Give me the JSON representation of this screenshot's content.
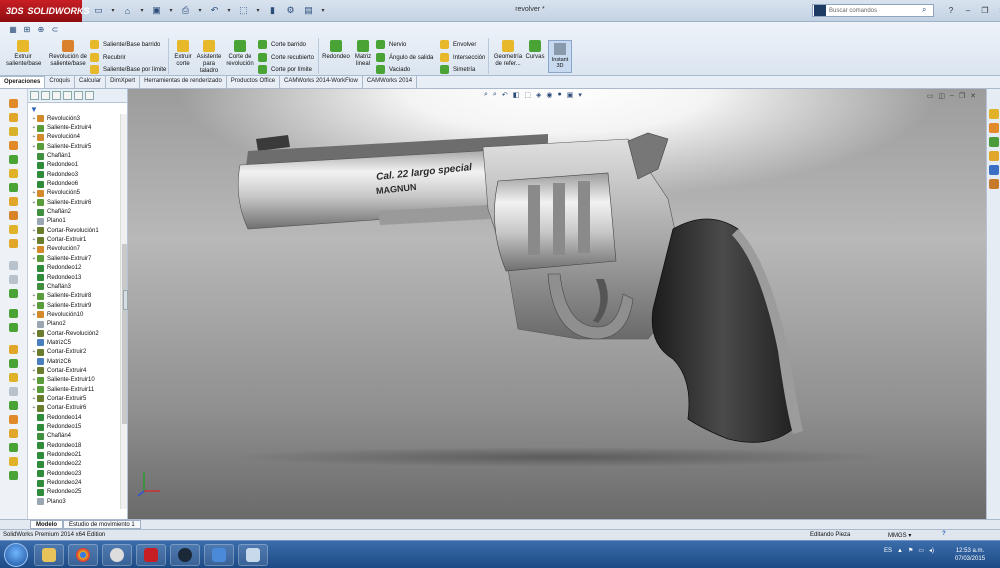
{
  "app": {
    "logo_text": "SOLIDWORKS",
    "doc_title": "revolver *",
    "search_placeholder": "Buscar comandos"
  },
  "ribbon": {
    "buttons": [
      {
        "label": "Extruir saliente/base"
      },
      {
        "label": "Revolución de saliente/base"
      },
      {
        "label": "Extruir corte"
      },
      {
        "label": "Asistente para taladro"
      },
      {
        "label": "Corte de revolución"
      },
      {
        "label": "Redondeo"
      },
      {
        "label": "Matriz lineal"
      },
      {
        "label": "Geometría de refer..."
      },
      {
        "label": "Curvas"
      },
      {
        "label": "Instant 3D"
      }
    ],
    "small": [
      {
        "label": "Saliente/Base barrido"
      },
      {
        "label": "Recubrir"
      },
      {
        "label": "Saliente/Base por límite"
      },
      {
        "label": "Corte barrido"
      },
      {
        "label": "Corte recubierto"
      },
      {
        "label": "Corte por límite"
      },
      {
        "label": "Nervio"
      },
      {
        "label": "Ángulo de salida"
      },
      {
        "label": "Vaciado"
      },
      {
        "label": "Envolver"
      },
      {
        "label": "Intersección"
      },
      {
        "label": "Simetría"
      }
    ]
  },
  "tabs": [
    "Operaciones",
    "Croquis",
    "Calcular",
    "DimXpert",
    "Herramientas de renderizado",
    "Productos Office",
    "CAMWorks 2014-WorkFlow",
    "CAMWorks 2014"
  ],
  "tree": [
    {
      "label": "Revolución3",
      "icon": "revolve",
      "exp": "+"
    },
    {
      "label": "Saliente-Extruir4",
      "icon": "extrude",
      "exp": "+"
    },
    {
      "label": "Revolución4",
      "icon": "revolve",
      "exp": "+"
    },
    {
      "label": "Saliente-Extruir5",
      "icon": "extrude",
      "exp": "+"
    },
    {
      "label": "Chaflán1",
      "icon": "chamfer",
      "exp": ""
    },
    {
      "label": "Redondeo1",
      "icon": "fillet",
      "exp": ""
    },
    {
      "label": "Redondeo3",
      "icon": "fillet",
      "exp": ""
    },
    {
      "label": "Redondeo6",
      "icon": "fillet",
      "exp": ""
    },
    {
      "label": "Revolución5",
      "icon": "revolve",
      "exp": "+"
    },
    {
      "label": "Saliente-Extruir6",
      "icon": "extrude",
      "exp": "+"
    },
    {
      "label": "Chaflán2",
      "icon": "chamfer",
      "exp": ""
    },
    {
      "label": "Plano1",
      "icon": "plane",
      "exp": ""
    },
    {
      "label": "Cortar-Revolución1",
      "icon": "cut",
      "exp": "+"
    },
    {
      "label": "Cortar-Extruir1",
      "icon": "cut",
      "exp": "+"
    },
    {
      "label": "Revolución7",
      "icon": "revolve",
      "exp": "+"
    },
    {
      "label": "Saliente-Extruir7",
      "icon": "extrude",
      "exp": "+"
    },
    {
      "label": "Redondeo12",
      "icon": "fillet",
      "exp": ""
    },
    {
      "label": "Redondeo13",
      "icon": "fillet",
      "exp": ""
    },
    {
      "label": "Chaflán3",
      "icon": "chamfer",
      "exp": ""
    },
    {
      "label": "Saliente-Extruir8",
      "icon": "extrude",
      "exp": "+"
    },
    {
      "label": "Saliente-Extruir9",
      "icon": "extrude",
      "exp": "+"
    },
    {
      "label": "Revolución10",
      "icon": "revolve",
      "exp": "+"
    },
    {
      "label": "Plano2",
      "icon": "plane",
      "exp": ""
    },
    {
      "label": "Cortar-Revolución2",
      "icon": "cut",
      "exp": "+"
    },
    {
      "label": "MatrizC5",
      "icon": "pattern",
      "exp": ""
    },
    {
      "label": "Cortar-Extruir2",
      "icon": "cut",
      "exp": "+"
    },
    {
      "label": "MatrizC6",
      "icon": "pattern",
      "exp": ""
    },
    {
      "label": "Cortar-Extruir4",
      "icon": "cut",
      "exp": "+"
    },
    {
      "label": "Saliente-Extruir10",
      "icon": "extrude",
      "exp": "+"
    },
    {
      "label": "Saliente-Extruir11",
      "icon": "extrude",
      "exp": "+"
    },
    {
      "label": "Cortar-Extruir5",
      "icon": "cut",
      "exp": "+"
    },
    {
      "label": "Cortar-Extruir6",
      "icon": "cut",
      "exp": "+"
    },
    {
      "label": "Redondeo14",
      "icon": "fillet",
      "exp": ""
    },
    {
      "label": "Redondeo15",
      "icon": "fillet",
      "exp": ""
    },
    {
      "label": "Chaflán4",
      "icon": "chamfer",
      "exp": ""
    },
    {
      "label": "Redondeo18",
      "icon": "fillet",
      "exp": ""
    },
    {
      "label": "Redondeo21",
      "icon": "fillet",
      "exp": ""
    },
    {
      "label": "Redondeo22",
      "icon": "fillet",
      "exp": ""
    },
    {
      "label": "Redondeo23",
      "icon": "fillet",
      "exp": ""
    },
    {
      "label": "Redondeo24",
      "icon": "fillet",
      "exp": ""
    },
    {
      "label": "Redondeo25",
      "icon": "fillet",
      "exp": ""
    },
    {
      "label": "Plano3",
      "icon": "plane",
      "exp": ""
    }
  ],
  "icon_colors": {
    "revolve": "#d48a2a",
    "extrude": "#5a9c3a",
    "chamfer": "#3f8f3f",
    "fillet": "#2e8c3a",
    "plane": "#9aa6b2",
    "cut": "#6a7d2d",
    "pattern": "#4a7fc0"
  },
  "viewport": {
    "engrave_line1": "Cal. 22 largo special",
    "engrave_line2": "MAGNUN"
  },
  "bottom_tabs": [
    "Modelo",
    "Estudio de movimiento 1"
  ],
  "status": {
    "product": "SolidWorks Premium 2014 x64 Edition",
    "mode": "Editando Pieza",
    "units": "MMGS",
    "units_arrow": "▾",
    "help": "?"
  },
  "taskbar": {
    "lang": "ES",
    "time": "12:53 a.m.",
    "date": "07/03/2015"
  }
}
